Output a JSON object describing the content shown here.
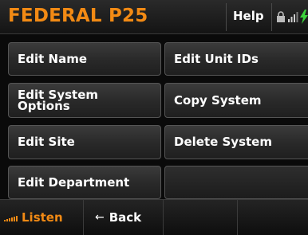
{
  "header": {
    "title": "FEDERAL P25",
    "help_label": "Help"
  },
  "menu": {
    "buttons": [
      {
        "label": "Edit Name"
      },
      {
        "label": "Edit Unit IDs"
      },
      {
        "label": "Edit System Options"
      },
      {
        "label": "Copy System"
      },
      {
        "label": "Edit Site"
      },
      {
        "label": "Delete System"
      },
      {
        "label": "Edit Department"
      },
      {
        "label": ""
      }
    ]
  },
  "footer": {
    "listen_label": "Listen",
    "back_arrow": "←",
    "back_label": "Back"
  },
  "colors": {
    "accent": "#f28a14",
    "button_text": "#ffffff",
    "background": "#0a0a0a"
  },
  "icons": [
    "lock-icon",
    "signal-icon",
    "battery-charging-icon",
    "listen-signal-icon",
    "back-arrow-icon"
  ]
}
